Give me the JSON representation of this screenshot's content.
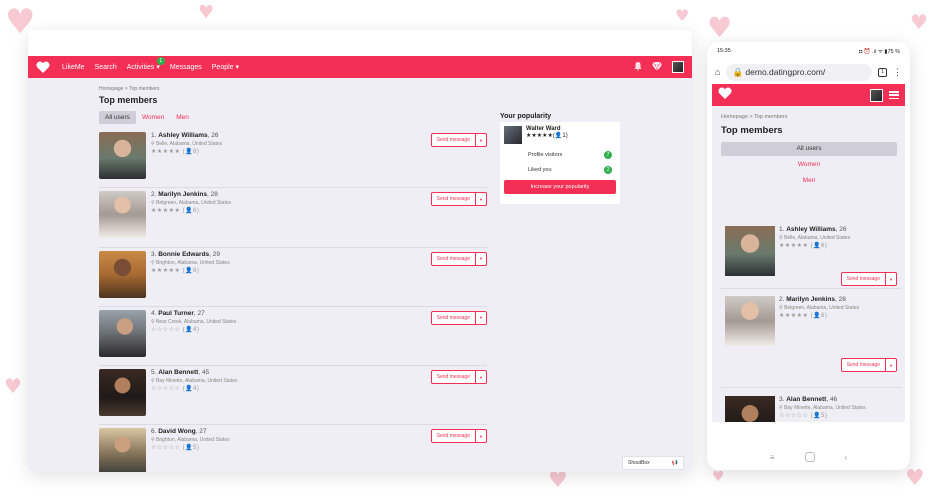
{
  "desktop": {
    "navbar": {
      "logo_icon": "heart-logo",
      "items": [
        {
          "label": "LikeMe"
        },
        {
          "label": "Search"
        },
        {
          "label": "Activities",
          "badge": "1",
          "has_caret": true
        },
        {
          "label": "Messages"
        },
        {
          "label": "People",
          "has_caret": true
        }
      ],
      "right_icons": [
        "bell-icon",
        "diamond-icon",
        "avatar"
      ]
    },
    "breadcrumb": "Homepage > Top members",
    "title": "Top members",
    "tabs": [
      {
        "label": "All users",
        "active": true
      },
      {
        "label": "Women",
        "active": false
      },
      {
        "label": "Men",
        "active": false
      }
    ],
    "members": [
      {
        "rank": "1.",
        "name": "Ashley Williams",
        "age": ", 26",
        "location": "Belle, Alabama, United States",
        "stars": "★★★★★",
        "rating": "(👤6)",
        "send_label": "Send message"
      },
      {
        "rank": "2.",
        "name": "Marilyn Jenkins",
        "age": ", 28",
        "location": "Belgreen, Alabama, United States",
        "stars": "★★★★★",
        "rating": "(👤6)",
        "send_label": "Send message"
      },
      {
        "rank": "3.",
        "name": "Bonnie Edwards",
        "age": ", 29",
        "location": "Brighton, Alabama, United States",
        "stars": "★★★★★",
        "rating": "(👤6)",
        "send_label": "Send message"
      },
      {
        "rank": "4.",
        "name": "Paul Turner",
        "age": ", 27",
        "location": "Bear Creek, Alabama, United States",
        "stars": "☆☆☆☆☆",
        "rating": "(👤4)",
        "send_label": "Send message"
      },
      {
        "rank": "5.",
        "name": "Alan Bennett",
        "age": ", 45",
        "location": "Bay Minette, Alabama, United States",
        "stars": "☆☆☆☆☆",
        "rating": "(👤4)",
        "send_label": "Send message"
      },
      {
        "rank": "6.",
        "name": "David Wong",
        "age": ", 27",
        "location": "Brighton, Alabama, United States",
        "stars": "☆☆☆☆☆",
        "rating": "(👤5)",
        "send_label": "Send message"
      }
    ],
    "popularity": {
      "title": "Your popularity",
      "user_name": "Walter Ward",
      "stars": "★★★★★",
      "rating": "(👤1)",
      "profile_visitors_label": "Profile visitors",
      "profile_visitors_count": "7",
      "liked_you_label": "Liked you",
      "liked_you_count": "2",
      "button_label": "Increase your popularity"
    },
    "shoutbox": {
      "label": "ShoutBox",
      "icon": "megaphone-icon"
    }
  },
  "mobile": {
    "status_time": "15:35",
    "status_right": "◘ ⏰ .ıl ᯤ ▮75 %",
    "url": "demo.datingpro.com/",
    "tab_count": "1",
    "breadcrumb": "Homepage > Top members",
    "title": "Top members",
    "tabs": [
      {
        "label": "All users",
        "active": true
      },
      {
        "label": "Women",
        "active": false
      },
      {
        "label": "Men",
        "active": false
      }
    ],
    "members": [
      {
        "rank": "1.",
        "name": "Ashley Williams",
        "age": ", 26",
        "location": "Belle, Alabama, United States",
        "stars": "★★★★★",
        "rating": "(👤6)",
        "send_label": "Send message"
      },
      {
        "rank": "2.",
        "name": "Marilyn Jenkins",
        "age": ", 28",
        "location": "Belgreen, Alabama, United States",
        "stars": "★★★★★",
        "rating": "(👤6)",
        "send_label": "Send message"
      },
      {
        "rank": "3.",
        "name": "Alan Bennett",
        "age": ", 46",
        "location": "Bay Minette, Alabama, United States",
        "stars": "☆☆☆☆☆",
        "rating": "(👤5)",
        "send_label": "Send message"
      }
    ],
    "nav_buttons": {
      "menu": "≡",
      "home": "",
      "back": "‹"
    }
  },
  "colors": {
    "brand": "#f42f56",
    "badge": "#2eb04c",
    "page_bg": "#efeef4"
  }
}
